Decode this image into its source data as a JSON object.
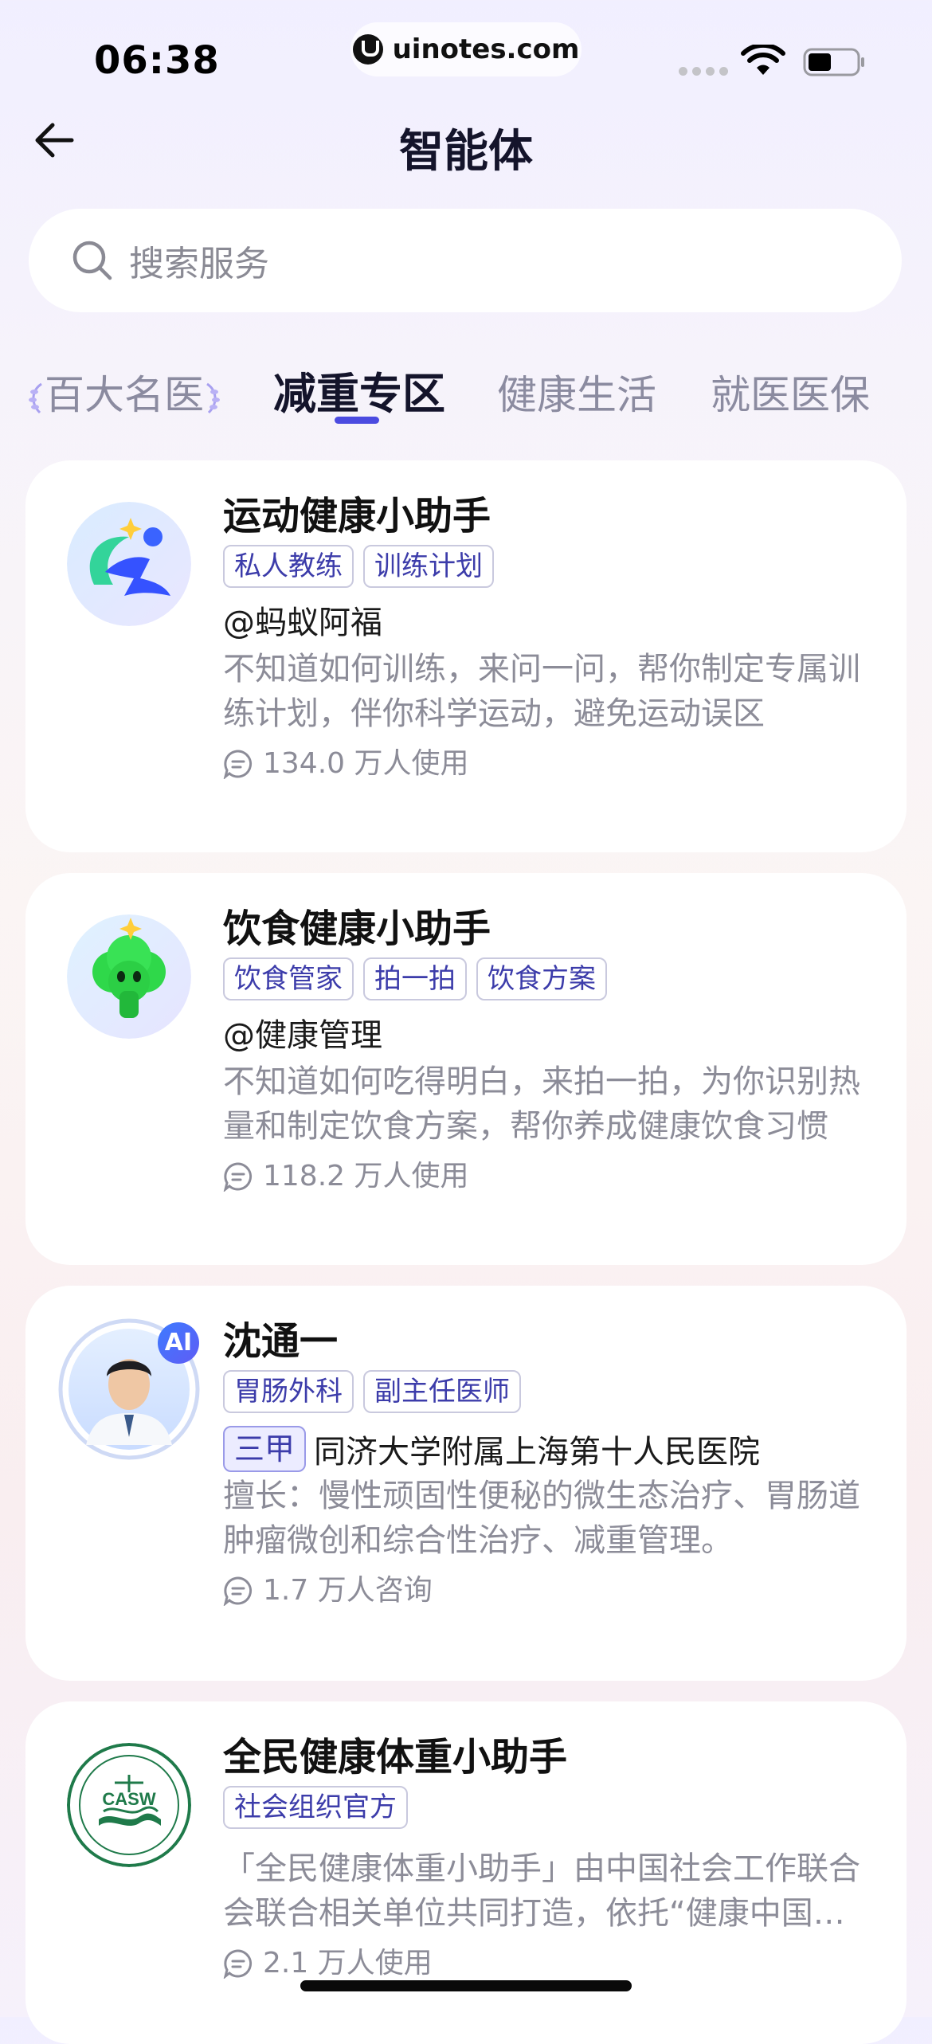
{
  "status_bar": {
    "time": "06:38",
    "url": "uinotes.com",
    "icons": [
      "signal-dots-icon",
      "wifi-icon",
      "battery-icon"
    ]
  },
  "header": {
    "title": "智能体",
    "back_icon": "back-arrow-icon"
  },
  "search": {
    "placeholder": "搜索服务",
    "icon": "search-icon"
  },
  "tabs": [
    {
      "label": "百大名医",
      "active": false
    },
    {
      "label": "减重专区",
      "active": true
    },
    {
      "label": "健康生活",
      "active": false
    },
    {
      "label": "就医医保",
      "active": false
    }
  ],
  "accent_color": "#4b4be0",
  "cards": [
    {
      "title": "运动健康小助手",
      "tags": [
        "私人教练",
        "训练计划"
      ],
      "author": "@蚂蚁阿福",
      "description": "不知道如何训练，来问一问，帮你制定专属训练计划，伴你科学运动，避免运动误区",
      "usage": "134.0 万人使用",
      "avatar_icon": "running-figure-icon"
    },
    {
      "title": "饮食健康小助手",
      "tags": [
        "饮食管家",
        "拍一拍",
        "饮食方案"
      ],
      "author": "@健康管理",
      "description": "不知道如何吃得明白，来拍一拍，为你识别热量和制定饮食方案，帮你养成健康饮食习惯",
      "usage": "118.2 万人使用",
      "avatar_icon": "broccoli-icon"
    },
    {
      "title": "沈通一",
      "tags": [
        "胃肠外科",
        "副主任医师"
      ],
      "level": "三甲",
      "hospital": "同济大学附属上海第十人民医院",
      "description": "擅长：慢性顽固性便秘的微生态治疗、胃肠道肿瘤微创和综合性治疗、减重管理。",
      "usage": "1.7 万人咨询",
      "ai_badge": "AI",
      "avatar_icon": "doctor-portrait-icon"
    },
    {
      "title": "全民健康体重小助手",
      "tags": [
        "社会组织官方"
      ],
      "description": "「全民健康体重小助手」由中国社会工作联合会联合相关单位共同打造，依托“健康中国行动”，以科学方法助力全民体重管理",
      "usage": "2.1 万人使用",
      "logo_text": "CASW",
      "avatar_icon": "casw-logo-icon"
    }
  ]
}
